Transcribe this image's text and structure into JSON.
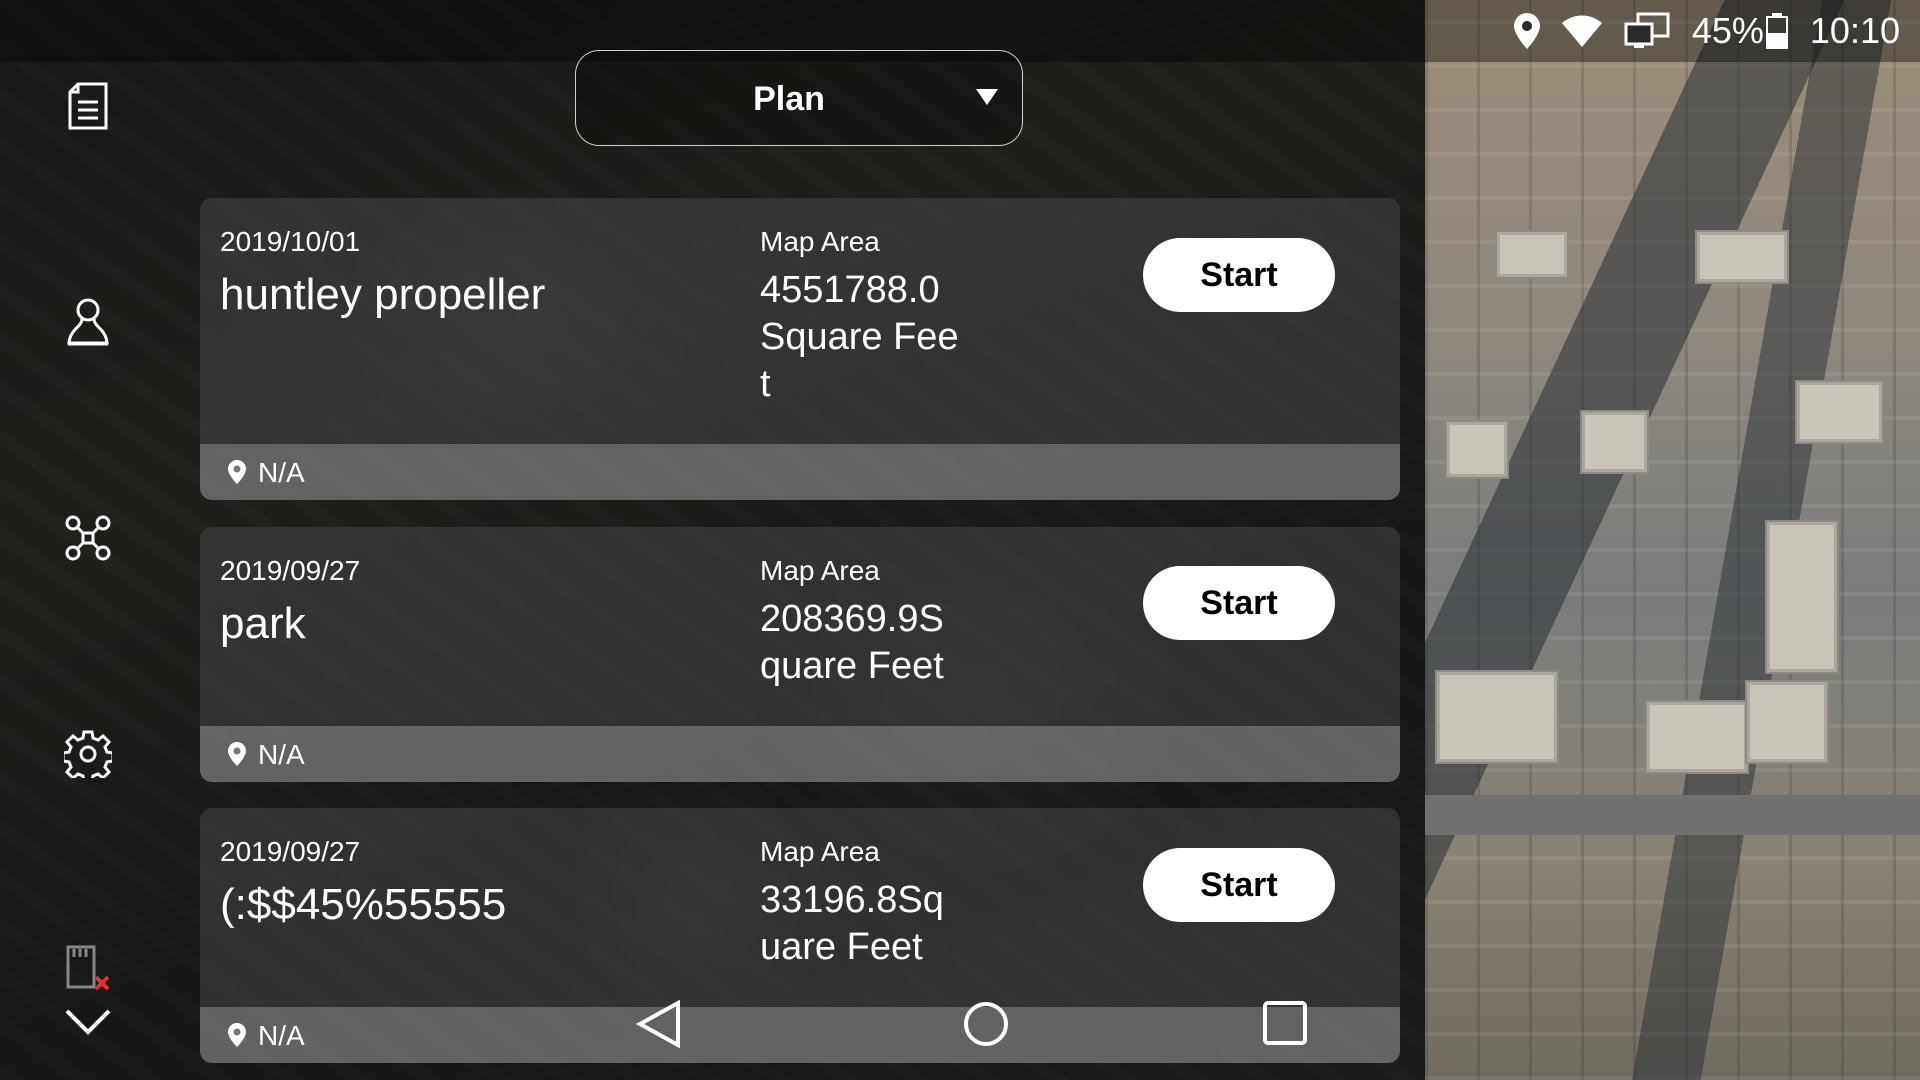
{
  "status_bar": {
    "battery": "45%",
    "time": "10:10",
    "icons": [
      "location-icon",
      "wifi-icon",
      "screen-mirror-icon",
      "battery-icon"
    ]
  },
  "sidebar": {
    "items": [
      {
        "name": "mission-list",
        "icon": "document-icon"
      },
      {
        "name": "account",
        "icon": "user-icon"
      },
      {
        "name": "aircraft",
        "icon": "drone-icon"
      },
      {
        "name": "settings",
        "icon": "gear-icon"
      },
      {
        "name": "sd-card",
        "icon": "sd-card-error-icon"
      },
      {
        "name": "collapse",
        "icon": "chevron-down-icon"
      }
    ]
  },
  "plan_dropdown": {
    "label": "Plan"
  },
  "missions": [
    {
      "date": "2019/10/01",
      "name": "huntley propeller",
      "area_label": "Map Area",
      "area_value": "4551788.0 Square Feet",
      "start_label": "Start",
      "location": "N/A"
    },
    {
      "date": "2019/09/27",
      "name": "park",
      "area_label": "Map Area",
      "area_value": "208369.9Square Feet",
      "start_label": "Start",
      "location": "N/A"
    },
    {
      "date": "2019/09/27",
      "name": "(:$$45%55555",
      "area_label": "Map Area",
      "area_value": "33196.8Square Feet",
      "start_label": "Start",
      "location": "N/A"
    }
  ],
  "nav_bar": {
    "icons": [
      "back-icon",
      "home-icon",
      "recents-icon"
    ]
  },
  "colors": {
    "card_bg": "#464646",
    "button_bg": "#ffffff",
    "button_text": "#000000",
    "sd_error": "#e03030"
  }
}
